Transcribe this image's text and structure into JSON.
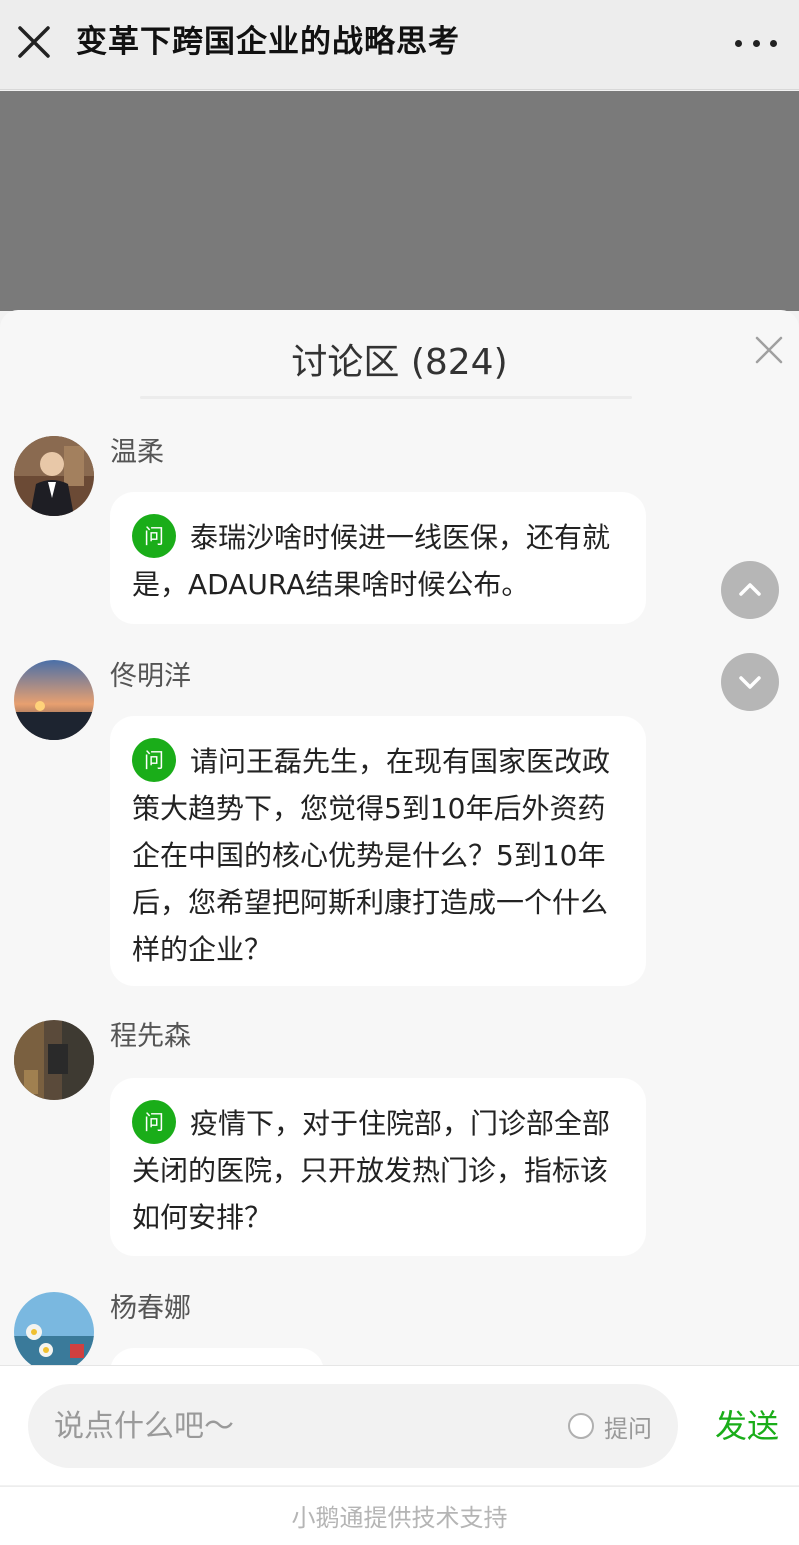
{
  "header": {
    "title": "变革下跨国企业的战略思考",
    "close_icon": "close-icon",
    "more_icon": "more-dots-icon"
  },
  "panel": {
    "title": "讨论区 (824)",
    "close_icon": "close-icon"
  },
  "comments": [
    {
      "user": "温柔",
      "badge": "问",
      "text": "泰瑞沙啥时候进一线医保，还有就是，ADAURA结果啥时候公布。"
    },
    {
      "user": "佟明洋",
      "badge": "问",
      "text": "请问王磊先生，在现有国家医改政策大趋势下，您觉得5到10年后外资药企在中国的核心优势是什么？5到10年后，您希望把阿斯利康打造成一个什么样的企业？"
    },
    {
      "user": "程先森",
      "badge": "问",
      "text": "疫情下，对于住院部，门诊部全部关闭的医院，只开放发热门诊，指标该如何安排？"
    },
    {
      "user": "杨春娜"
    }
  ],
  "scroll": {
    "up_icon": "chevron-up-icon",
    "down_icon": "chevron-down-icon"
  },
  "composer": {
    "placeholder": "说点什么吧～",
    "ask_label": "提问",
    "send_label": "发送"
  },
  "footer": {
    "text": "小鹅通提供技术支持"
  },
  "colors": {
    "accent": "#1aad19",
    "video_bg": "#7a7a7a",
    "panel_bg": "#f7f7f7"
  }
}
